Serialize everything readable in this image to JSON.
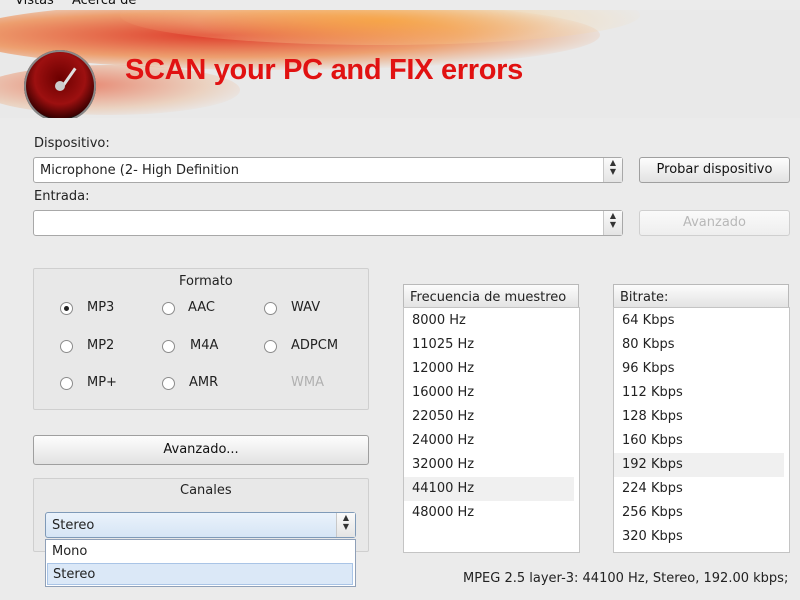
{
  "menu": {
    "vistas": "Vistas",
    "acerca": "Acerca de"
  },
  "banner": {
    "title": "SCAN your PC and FIX errors",
    "icon": "speedometer-icon"
  },
  "device": {
    "label": "Dispositivo:",
    "value": "Microphone (2- High Definition",
    "test_button": "Probar dispositivo"
  },
  "input": {
    "label": "Entrada:",
    "value": "",
    "advanced_button": "Avanzado"
  },
  "format": {
    "title": "Formato",
    "options": [
      "MP3",
      "AAC",
      "WAV",
      "MP2",
      "M4A",
      "ADPCM",
      "MP+",
      "AMR",
      "WMA"
    ],
    "selected": "MP3",
    "disabled": [
      "WMA"
    ]
  },
  "advanced_button": "Avanzado...",
  "channels": {
    "title": "Canales",
    "value": "Stereo",
    "options": [
      "Mono",
      "Stereo"
    ],
    "highlighted": "Stereo"
  },
  "sample_rate": {
    "header": "Frecuencia de muestreo",
    "items": [
      "8000 Hz",
      "11025 Hz",
      "12000 Hz",
      "16000 Hz",
      "22050 Hz",
      "24000 Hz",
      "32000 Hz",
      "44100 Hz",
      "48000 Hz"
    ],
    "selected": "44100 Hz"
  },
  "bitrate": {
    "header": "Bitrate:",
    "items": [
      "64 Kbps",
      "80 Kbps",
      "96 Kbps",
      "112 Kbps",
      "128 Kbps",
      "160 Kbps",
      "192 Kbps",
      "224 Kbps",
      "256 Kbps",
      "320 Kbps"
    ],
    "selected": "192 Kbps"
  },
  "status": "MPEG 2.5 layer-3: 44100 Hz,  Stereo, 192.00 kbps;",
  "colors": {
    "banner_title": "#e11212",
    "selection": "#dbe8f7"
  }
}
